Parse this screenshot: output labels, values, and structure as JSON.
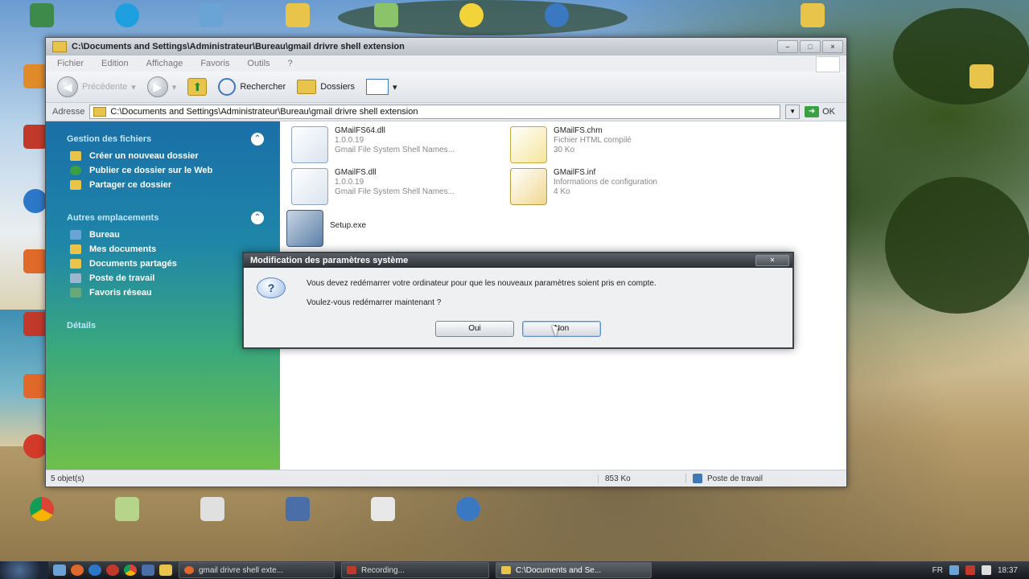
{
  "explorer": {
    "title": "C:\\Documents and Settings\\Administrateur\\Bureau\\gmail drivre shell extension",
    "menu": [
      "Fichier",
      "Edition",
      "Affichage",
      "Favoris",
      "Outils",
      "?"
    ],
    "toolbar": {
      "back": "Précédente",
      "search": "Rechercher",
      "folders": "Dossiers"
    },
    "address": {
      "label": "Adresse",
      "path": "C:\\Documents and Settings\\Administrateur\\Bureau\\gmail drivre shell extension",
      "go": "OK"
    },
    "sidebar": {
      "tasks_header": "Gestion des fichiers",
      "tasks": [
        "Créer un nouveau dossier",
        "Publier ce dossier sur le Web",
        "Partager ce dossier"
      ],
      "places_header": "Autres emplacements",
      "places": [
        "Bureau",
        "Mes documents",
        "Documents partagés",
        "Poste de travail",
        "Favoris réseau"
      ],
      "details_header": "Détails"
    },
    "files": [
      {
        "name": "GMailFS64.dll",
        "line2": "1.0.0.19",
        "line3": "Gmail File System Shell Names..."
      },
      {
        "name": "GMailFS.chm",
        "line2": "Fichier HTML compilé",
        "line3": "30 Ko"
      },
      {
        "name": "GMailFS.dll",
        "line2": "1.0.0.19",
        "line3": "Gmail File System Shell Names..."
      },
      {
        "name": "GMailFS.inf",
        "line2": "Informations de configuration",
        "line3": "4 Ko"
      },
      {
        "name": "Setup.exe",
        "line2": "",
        "line3": ""
      }
    ],
    "status": {
      "objects": "5 objet(s)",
      "size": "853 Ko",
      "location": "Poste de travail"
    }
  },
  "dialog": {
    "title": "Modification des paramètres système",
    "message": "Vous devez redémarrer votre ordinateur pour que les nouveaux paramètres soient pris en compte.",
    "question": "Voulez-vous redémarrer maintenant ?",
    "yes": "Oui",
    "no": "Non"
  },
  "taskbar": {
    "tasks": [
      "gmail drivre shell exte...",
      "Recording...",
      "C:\\Documents and Se..."
    ],
    "lang": "FR",
    "clock": "18:37"
  },
  "colors": {
    "sidebar_top": "#1a6fa7",
    "sidebar_bottom": "#6fbf4a",
    "dialog_title": "#2d3137"
  }
}
